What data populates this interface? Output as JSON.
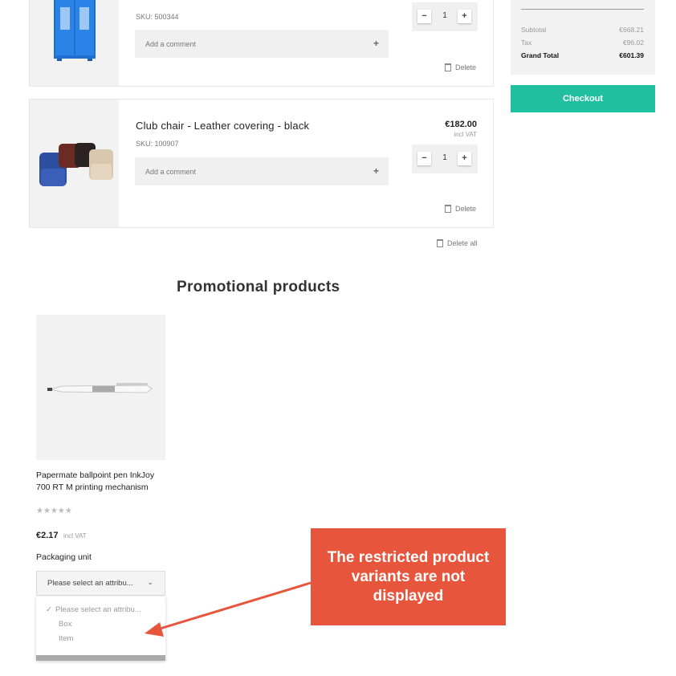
{
  "cart": {
    "items": [
      {
        "name": "",
        "sku": "SKU: 500344",
        "comment_label": "Add a comment",
        "comment_icon": "plus-icon",
        "quantity": "1",
        "delete_label": "Delete"
      },
      {
        "name": "Club chair - Leather covering - black",
        "sku": "SKU: 100907",
        "price": "€182.00",
        "vat": "incl VAT",
        "comment_label": "Add a comment",
        "comment_icon": "plus-icon",
        "quantity": "1",
        "delete_label": "Delete"
      }
    ],
    "delete_all_label": "Delete all",
    "qty_minus": "−",
    "qty_plus": "+"
  },
  "summary": {
    "subtotal_label": "Subtotal",
    "subtotal_value": "€668.21",
    "tax_label": "Tax",
    "tax_value": "€96.02",
    "grand_total_label": "Grand Total",
    "grand_total_value": "€601.39",
    "checkout_label": "Checkout",
    "accent_color": "#1fbf9f"
  },
  "promo": {
    "heading": "Promotional products",
    "product": {
      "name_line1": "Papermate ballpoint pen InkJoy",
      "name_line2": "700 RT M printing mechanism",
      "rating": 0,
      "rating_max": 5,
      "price": "€2.17",
      "vat": "incl VAT",
      "attribute_label": "Packaging unit",
      "select_value": "Please select an attribu...",
      "options": [
        {
          "label": "Please select an attribu...",
          "selected": true
        },
        {
          "label": "Box",
          "selected": false
        },
        {
          "label": "Item",
          "selected": false
        }
      ]
    }
  },
  "annotation": {
    "line1": "The restricted product",
    "line2": "variants are not",
    "line3": "displayed",
    "color": "#e8553d"
  }
}
